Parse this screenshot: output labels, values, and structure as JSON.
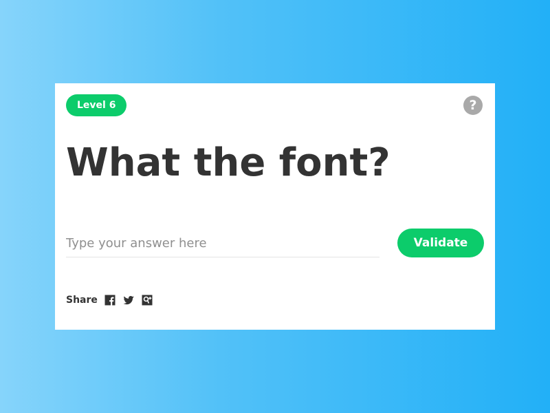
{
  "quiz": {
    "level_label": "Level 6",
    "help_icon": "question-circle-icon",
    "help_glyph": "?",
    "title": "What the font?",
    "answer": {
      "value": "",
      "placeholder": "Type your answer here"
    },
    "validate_label": "Validate"
  },
  "share": {
    "label": "Share",
    "icons": [
      "facebook-icon",
      "twitter-icon",
      "google-plus-icon"
    ]
  },
  "colors": {
    "accent": "#0ccc6b",
    "text": "#333333",
    "help": "#a9a9a9",
    "background_start": "#86d4fb",
    "background_end": "#22b0f7"
  }
}
